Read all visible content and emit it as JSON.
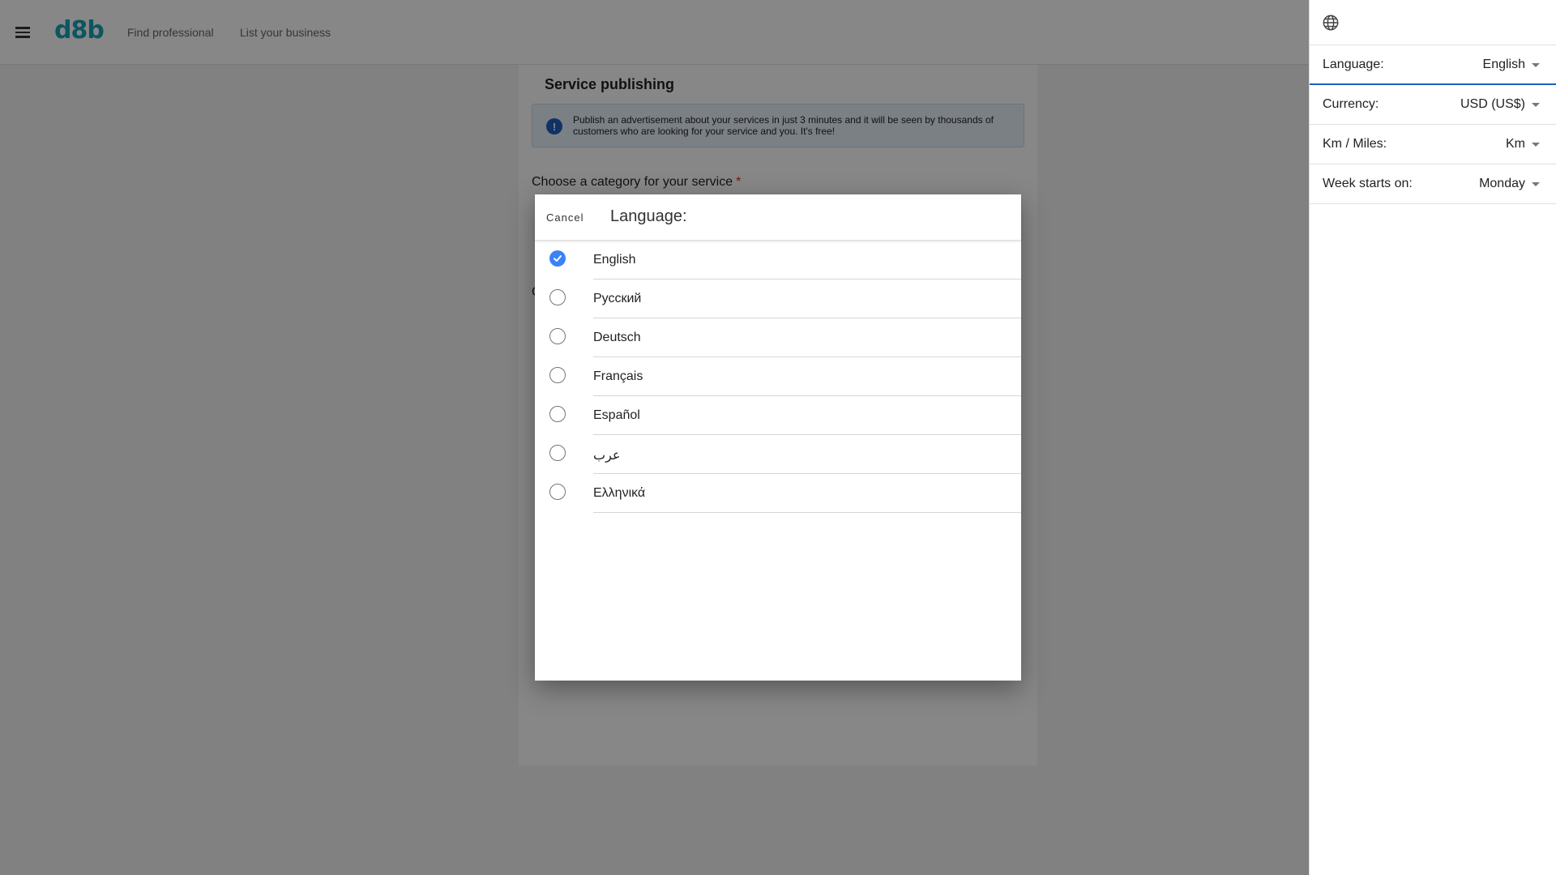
{
  "header": {
    "logo": "d8b",
    "nav": [
      "Find professional",
      "List your business"
    ]
  },
  "page": {
    "title": "Service publishing",
    "info_text": "Publish an advertisement about your services in just 3 minutes and it will be seen by thousands of customers who are looking for your service and you. It's free!",
    "info_icon": "!",
    "category_label": "Choose a category for your service",
    "required_mark": "*",
    "partial_char": "C"
  },
  "settings": {
    "rows": [
      {
        "label": "Language:",
        "value": "English"
      },
      {
        "label": "Currency:",
        "value": "USD (US$)"
      },
      {
        "label": "Km / Miles:",
        "value": "Km"
      },
      {
        "label": "Week starts on:",
        "value": "Monday"
      }
    ]
  },
  "dialog": {
    "cancel": "Cancel",
    "title": "Language:",
    "options": [
      "English",
      "Русский",
      "Deutsch",
      "Français",
      "Español",
      "عرب",
      "Ελληνικά"
    ],
    "selected": "English"
  },
  "colors": {
    "accent": "#3b82f6",
    "brand": "#17a2b8",
    "required": "#d32f2f"
  }
}
